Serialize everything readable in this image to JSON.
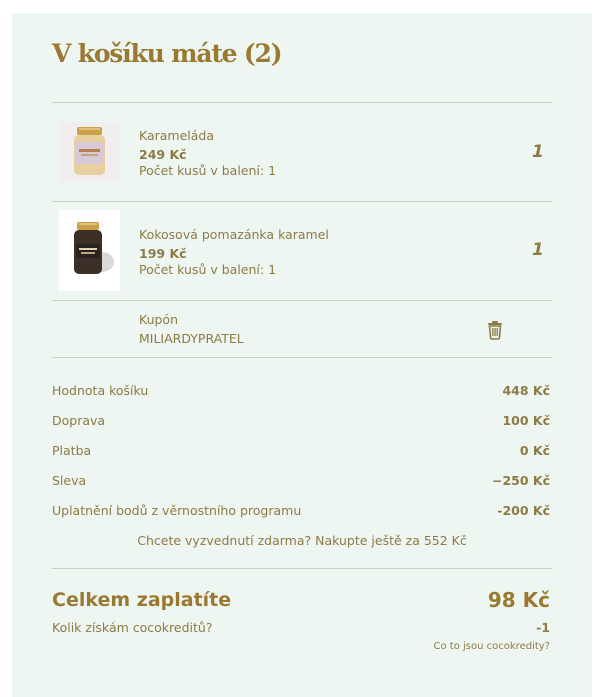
{
  "cart": {
    "title": "V košíku máte (2)",
    "items": [
      {
        "name": "Karameláda",
        "price": "249 Kč",
        "pack": "Počet kusů v balení: 1",
        "quantity": "1",
        "image_icon": "jar-product-image"
      },
      {
        "name": "Kokosová pomazánka karamel",
        "price": "199 Kč",
        "pack": "Počet kusů v balení: 1",
        "quantity": "1",
        "image_icon": "jar-product-image"
      }
    ],
    "coupon": {
      "label": "Kupón",
      "code": "MILIARDYPRATEL",
      "remove_icon": "trash-icon"
    }
  },
  "summary": {
    "rows": [
      {
        "label": "Hodnota košíku",
        "value": "448 Kč"
      },
      {
        "label": "Doprava",
        "value": "100 Kč"
      },
      {
        "label": "Platba",
        "value": "0 Kč"
      },
      {
        "label": "Sleva",
        "value": "−250 Kč"
      },
      {
        "label": "Uplatnění bodů z věrnostního programu",
        "value": "-200 Kč"
      }
    ],
    "free_shipping_note": "Chcete vyzvednutí zdarma? Nakupte ještě za 552 Kč"
  },
  "total": {
    "label": "Celkem zaplatíte",
    "value": "98 Kč",
    "credits_label": "Kolik získám cocokreditů?",
    "credits_value": "-1",
    "credits_link": "Co to jsou cocokredity?"
  },
  "colors": {
    "panel_background": "#eef6f1",
    "text": "#8c7b46",
    "heading": "#9a7a32",
    "divider": "#c9cfc6"
  }
}
